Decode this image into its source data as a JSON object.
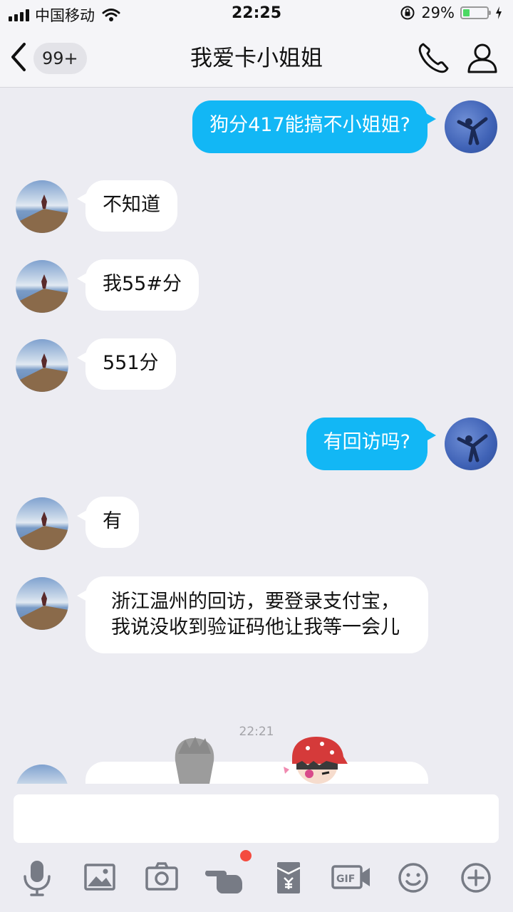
{
  "status_bar": {
    "carrier": "中国移动",
    "time": "22:25",
    "battery_percent": "29%",
    "battery_level": 0.29
  },
  "nav": {
    "unread_badge": "99+",
    "title": "我爱卡小姐姐"
  },
  "messages": [
    {
      "side": "out",
      "text": "狗分417能搞不小姐姐?"
    },
    {
      "side": "in",
      "text": "不知道"
    },
    {
      "side": "in",
      "text": "我55#分"
    },
    {
      "side": "in",
      "text": "551分"
    },
    {
      "side": "out",
      "text": "有回访吗?"
    },
    {
      "side": "in",
      "text": "有"
    },
    {
      "side": "in",
      "text": "浙江温州的回访，要登录支付宝，我说没收到验证码他让我等一会儿"
    }
  ],
  "timestamp": "22:21",
  "toolbar": [
    "microphone-icon",
    "image-icon",
    "camera-icon",
    "poke-icon",
    "red-packet-icon",
    "gif-icon",
    "emoji-icon",
    "plus-icon"
  ],
  "colors": {
    "outgoing_bubble": "#12b7f5",
    "incoming_bubble": "#ffffff",
    "background": "#ececf2",
    "notification_dot": "#f44b3f"
  }
}
